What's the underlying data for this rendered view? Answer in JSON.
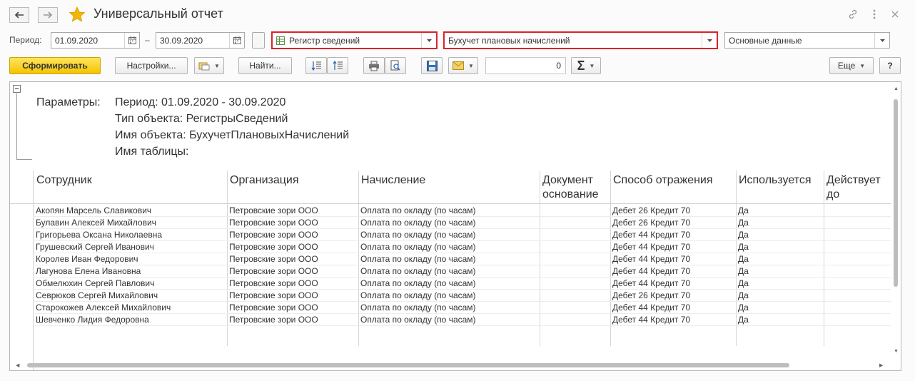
{
  "window": {
    "title": "Универсальный отчет"
  },
  "filters": {
    "period_label": "Период:",
    "date_from": "01.09.2020",
    "date_separator": "–",
    "date_to": "30.09.2020",
    "object_type": "Регистр сведений",
    "object_name": "Бухучет плановых начислений",
    "table_name": "Основные данные"
  },
  "toolbar": {
    "generate_label": "Сформировать",
    "settings_label": "Настройки...",
    "find_label": "Найти...",
    "sum_value": "0",
    "more_label": "Еще",
    "help_label": "?"
  },
  "report": {
    "params_label": "Параметры:",
    "params": [
      "Период: 01.09.2020 - 30.09.2020",
      "Тип объекта: РегистрыСведений",
      "Имя объекта: БухучетПлановыхНачислений",
      "Имя таблицы:"
    ],
    "columns": [
      {
        "line1": "Сотрудник",
        "line2": ""
      },
      {
        "line1": "Организация",
        "line2": ""
      },
      {
        "line1": "Начисление",
        "line2": ""
      },
      {
        "line1": "Документ",
        "line2": "основание"
      },
      {
        "line1": "Способ отражения",
        "line2": ""
      },
      {
        "line1": "Используется",
        "line2": ""
      },
      {
        "line1": "Действует",
        "line2": "до"
      }
    ],
    "rows": [
      {
        "employee": "Акопян Марсель Славикович",
        "org": "Петровские зори ООО",
        "accrual": "Оплата по окладу (по часам)",
        "doc": "",
        "method": "Дебет 26 Кредит 70",
        "used": "Да",
        "valid": ""
      },
      {
        "employee": "Булавин Алексей Михайлович",
        "org": "Петровские зори ООО",
        "accrual": "Оплата по окладу (по часам)",
        "doc": "",
        "method": "Дебет 26 Кредит 70",
        "used": "Да",
        "valid": ""
      },
      {
        "employee": "Григорьева Оксана Николаевна",
        "org": "Петровские зори ООО",
        "accrual": "Оплата по окладу (по часам)",
        "doc": "",
        "method": "Дебет 44 Кредит 70",
        "used": "Да",
        "valid": ""
      },
      {
        "employee": "Грушевский Сергей Иванович",
        "org": "Петровские зори ООО",
        "accrual": "Оплата по окладу (по часам)",
        "doc": "",
        "method": "Дебет 44 Кредит 70",
        "used": "Да",
        "valid": ""
      },
      {
        "employee": "Королев Иван Федорович",
        "org": "Петровские зори ООО",
        "accrual": "Оплата по окладу (по часам)",
        "doc": "",
        "method": "Дебет 44 Кредит 70",
        "used": "Да",
        "valid": ""
      },
      {
        "employee": "Лагунова Елена Ивановна",
        "org": "Петровские зори ООО",
        "accrual": "Оплата по окладу (по часам)",
        "doc": "",
        "method": "Дебет 44 Кредит 70",
        "used": "Да",
        "valid": ""
      },
      {
        "employee": "Обмелюхин Сергей Павлович",
        "org": "Петровские зори ООО",
        "accrual": "Оплата по окладу (по часам)",
        "doc": "",
        "method": "Дебет 44 Кредит 70",
        "used": "Да",
        "valid": ""
      },
      {
        "employee": "Севрюков Сергей Михайлович",
        "org": "Петровские зори ООО",
        "accrual": "Оплата по окладу (по часам)",
        "doc": "",
        "method": "Дебет 26 Кредит 70",
        "used": "Да",
        "valid": ""
      },
      {
        "employee": "Старокожев Алексей Михайлович",
        "org": "Петровские зори ООО",
        "accrual": "Оплата по окладу (по часам)",
        "doc": "",
        "method": "Дебет 44 Кредит 70",
        "used": "Да",
        "valid": ""
      },
      {
        "employee": "Шевченко Лидия Федоровна",
        "org": "Петровские зори ООО",
        "accrual": "Оплата по окладу (по часам)",
        "doc": "",
        "method": "Дебет 44 Кредит 70",
        "used": "Да",
        "valid": ""
      }
    ]
  },
  "icons": {
    "back": "arrow-left-icon",
    "forward": "arrow-right-icon",
    "favorite": "star-icon",
    "link": "link-icon",
    "menu": "more-vertical-icon",
    "close": "close-icon"
  },
  "colors": {
    "accent_yellow": "#f5c400",
    "highlight_red": "#d9242a",
    "star": "#f2b705"
  }
}
